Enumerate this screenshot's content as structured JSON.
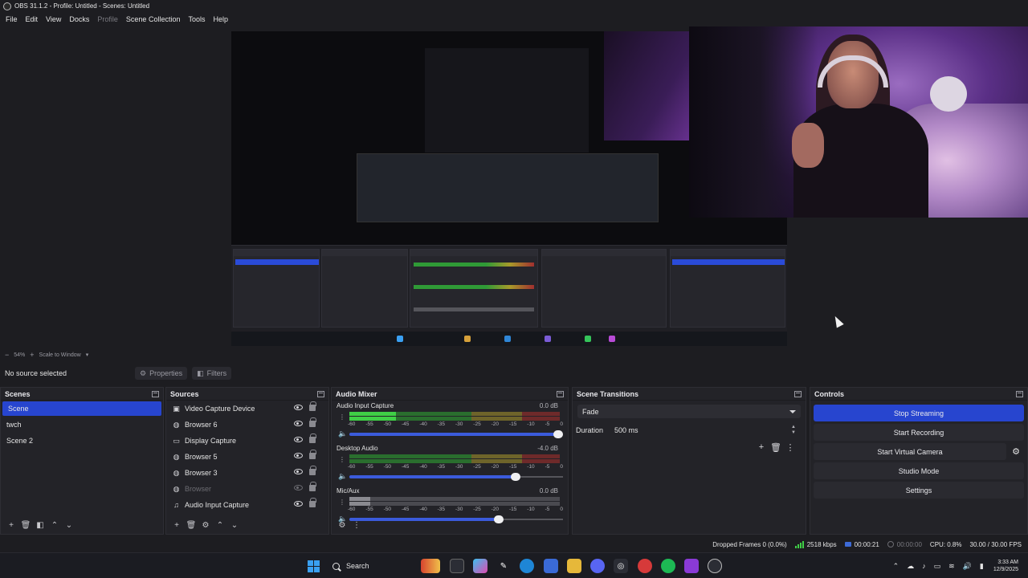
{
  "window": {
    "title": "OBS 31.1.2 - Profile: Untitled - Scenes: Untitled"
  },
  "menu": [
    "File",
    "Edit",
    "View",
    "Docks",
    "Profile",
    "Scene Collection",
    "Tools",
    "Help"
  ],
  "preview": {
    "zoom": "54%",
    "scale_mode": "Scale to Window"
  },
  "source_bar": {
    "no_source": "No source selected",
    "properties": "Properties",
    "filters": "Filters"
  },
  "scenes": {
    "title": "Scenes",
    "items": [
      "Scene",
      "twch",
      "Scene 2"
    ],
    "selected": "Scene"
  },
  "sources": {
    "title": "Sources",
    "items": [
      {
        "label": "Video Capture Device",
        "icon": "camera-icon",
        "visible": true
      },
      {
        "label": "Browser 6",
        "icon": "globe-icon",
        "visible": true
      },
      {
        "label": "Display Capture",
        "icon": "monitor-icon",
        "visible": true
      },
      {
        "label": "Browser 5",
        "icon": "globe-icon",
        "visible": true
      },
      {
        "label": "Browser 3",
        "icon": "globe-icon",
        "visible": true
      },
      {
        "label": "Browser",
        "icon": "globe-icon",
        "visible": false
      },
      {
        "label": "Audio Input Capture",
        "icon": "microphone-icon",
        "visible": true
      }
    ]
  },
  "mixer": {
    "title": "Audio Mixer",
    "ticks": [
      "-60",
      "-55",
      "-50",
      "-45",
      "-40",
      "-35",
      "-30",
      "-25",
      "-20",
      "-15",
      "-10",
      "-5",
      "0"
    ],
    "channels": [
      {
        "name": "Audio Input Capture",
        "db": "0.0 dB",
        "level": 0.22,
        "volume": 1.0,
        "muted": false
      },
      {
        "name": "Desktop Audio",
        "db": "-4.0 dB",
        "level": 0.0,
        "volume": 0.8,
        "muted": false
      },
      {
        "name": "Mic/Aux",
        "db": "0.0 dB",
        "level": 0.1,
        "volume": 0.72,
        "muted": true
      }
    ]
  },
  "transitions": {
    "title": "Scene Transitions",
    "selected": "Fade",
    "duration_label": "Duration",
    "duration_value": "500 ms"
  },
  "controls": {
    "title": "Controls",
    "stop_streaming": "Stop Streaming",
    "start_recording": "Start Recording",
    "start_virtual_camera": "Start Virtual Camera",
    "studio_mode": "Studio Mode",
    "settings": "Settings"
  },
  "status": {
    "dropped_frames": "Dropped Frames 0 (0.0%)",
    "bitrate": "2518 kbps",
    "stream_time": "00:00:21",
    "rec_time": "00:00:00",
    "cpu": "CPU: 0.8%",
    "fps": "30.00 / 30.00 FPS"
  },
  "taskbar": {
    "search_label": "Search",
    "time": "3:33 AM",
    "date": "12/9/2025"
  },
  "colors": {
    "accent": "#2745cf",
    "meter_green": "#3fcf46"
  }
}
